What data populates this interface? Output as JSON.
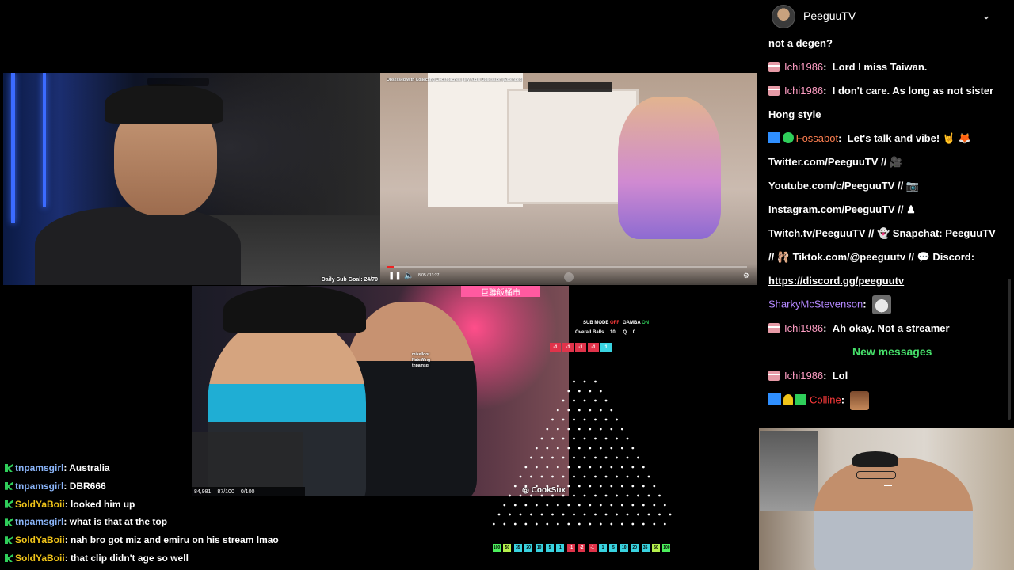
{
  "stream": {
    "street_overlay": "Daily Sub Goal: 24/70",
    "video_title": "Obsessed with Collecting Cockroaches | My Kid's Obsession (Extended)",
    "video_time": "8:05 / 13:27",
    "market_sign": "巨聯飯桶市",
    "market_overlay_user": "CookSux",
    "market_stats": [
      "84,981",
      "87/100",
      "0/100"
    ],
    "market_mini_lines": [
      "mikelloor",
      "NateWing",
      "tnpamsgi"
    ]
  },
  "widget": {
    "sub_mode_label": "SUB MODE",
    "sub_mode_value": "OFF",
    "gamba_label": "GAMBA",
    "gamba_value": "ON",
    "overall_balls_label": "Overall Balls",
    "overall_balls_value": "10",
    "queue_label": "Q",
    "queue_value": "0",
    "last_results": [
      "-1",
      "-1",
      "-1",
      "-1",
      "1"
    ],
    "slots": [
      "100",
      "50",
      "35",
      "20",
      "10",
      "5",
      "1",
      "-1",
      "-2",
      "-1",
      "1",
      "5",
      "10",
      "20",
      "35",
      "50",
      "100"
    ]
  },
  "bottom_chat": [
    {
      "user": "tnpamsgirl",
      "message": "Australia",
      "color": "#8ab4f8"
    },
    {
      "user": "tnpamsgirl",
      "message": "DBR666",
      "color": "#8ab4f8"
    },
    {
      "user": "SoldYaBoii",
      "message": "looked him up",
      "color": "#f0c419"
    },
    {
      "user": "tnpamsgirl",
      "message": "what is that at the top",
      "color": "#8ab4f8"
    },
    {
      "user": "SoldYaBoii",
      "message": "nah bro got miz and emiru on his stream lmao",
      "color": "#f0c419"
    },
    {
      "user": "SoldYaBoii",
      "message": "that clip didn't age so well",
      "color": "#f0c419"
    }
  ],
  "chat": {
    "channel": "PeeguuTV",
    "lines": {
      "l1": "not a degen?",
      "m2_user": "Ichi1986",
      "m2_text": "Lord I miss Taiwan.",
      "m3_user": "Ichi1986",
      "m3_text": "I don't care. As long as not sister",
      "m3_cont": "Hong style",
      "m4_user": "Fossabot",
      "m4_text": "Let's talk and vibe! 🤘 🦊",
      "l5": "Twitter.com/PeeguuTV // 🎥",
      "l6": "Youtube.com/c/PeeguuTV // 📷",
      "l7": "Instagram.com/PeeguuTV // ♟",
      "l8": "Twitch.tv/PeeguuTV // 👻 Snapchat: PeeguuTV",
      "l9": "// 🩰 Tiktok.com/@peeguutv // 💬 Discord:",
      "l10": "https://discord.gg/peeguutv",
      "m11_user": "SharkyMcStevenson",
      "m12_user": "Ichi1986",
      "m12_text": "Ah okay. Not a streamer",
      "new_messages": "New messages",
      "m13_user": "Ichi1986",
      "m13_text": "Lol",
      "m14_user": "Colline"
    },
    "colors": {
      "ichi": "#ff9ec4",
      "fossabot": "#ff7f50",
      "sharky": "#b488ff",
      "colline": "#ff3b3b",
      "separator": "#35d43a"
    }
  }
}
